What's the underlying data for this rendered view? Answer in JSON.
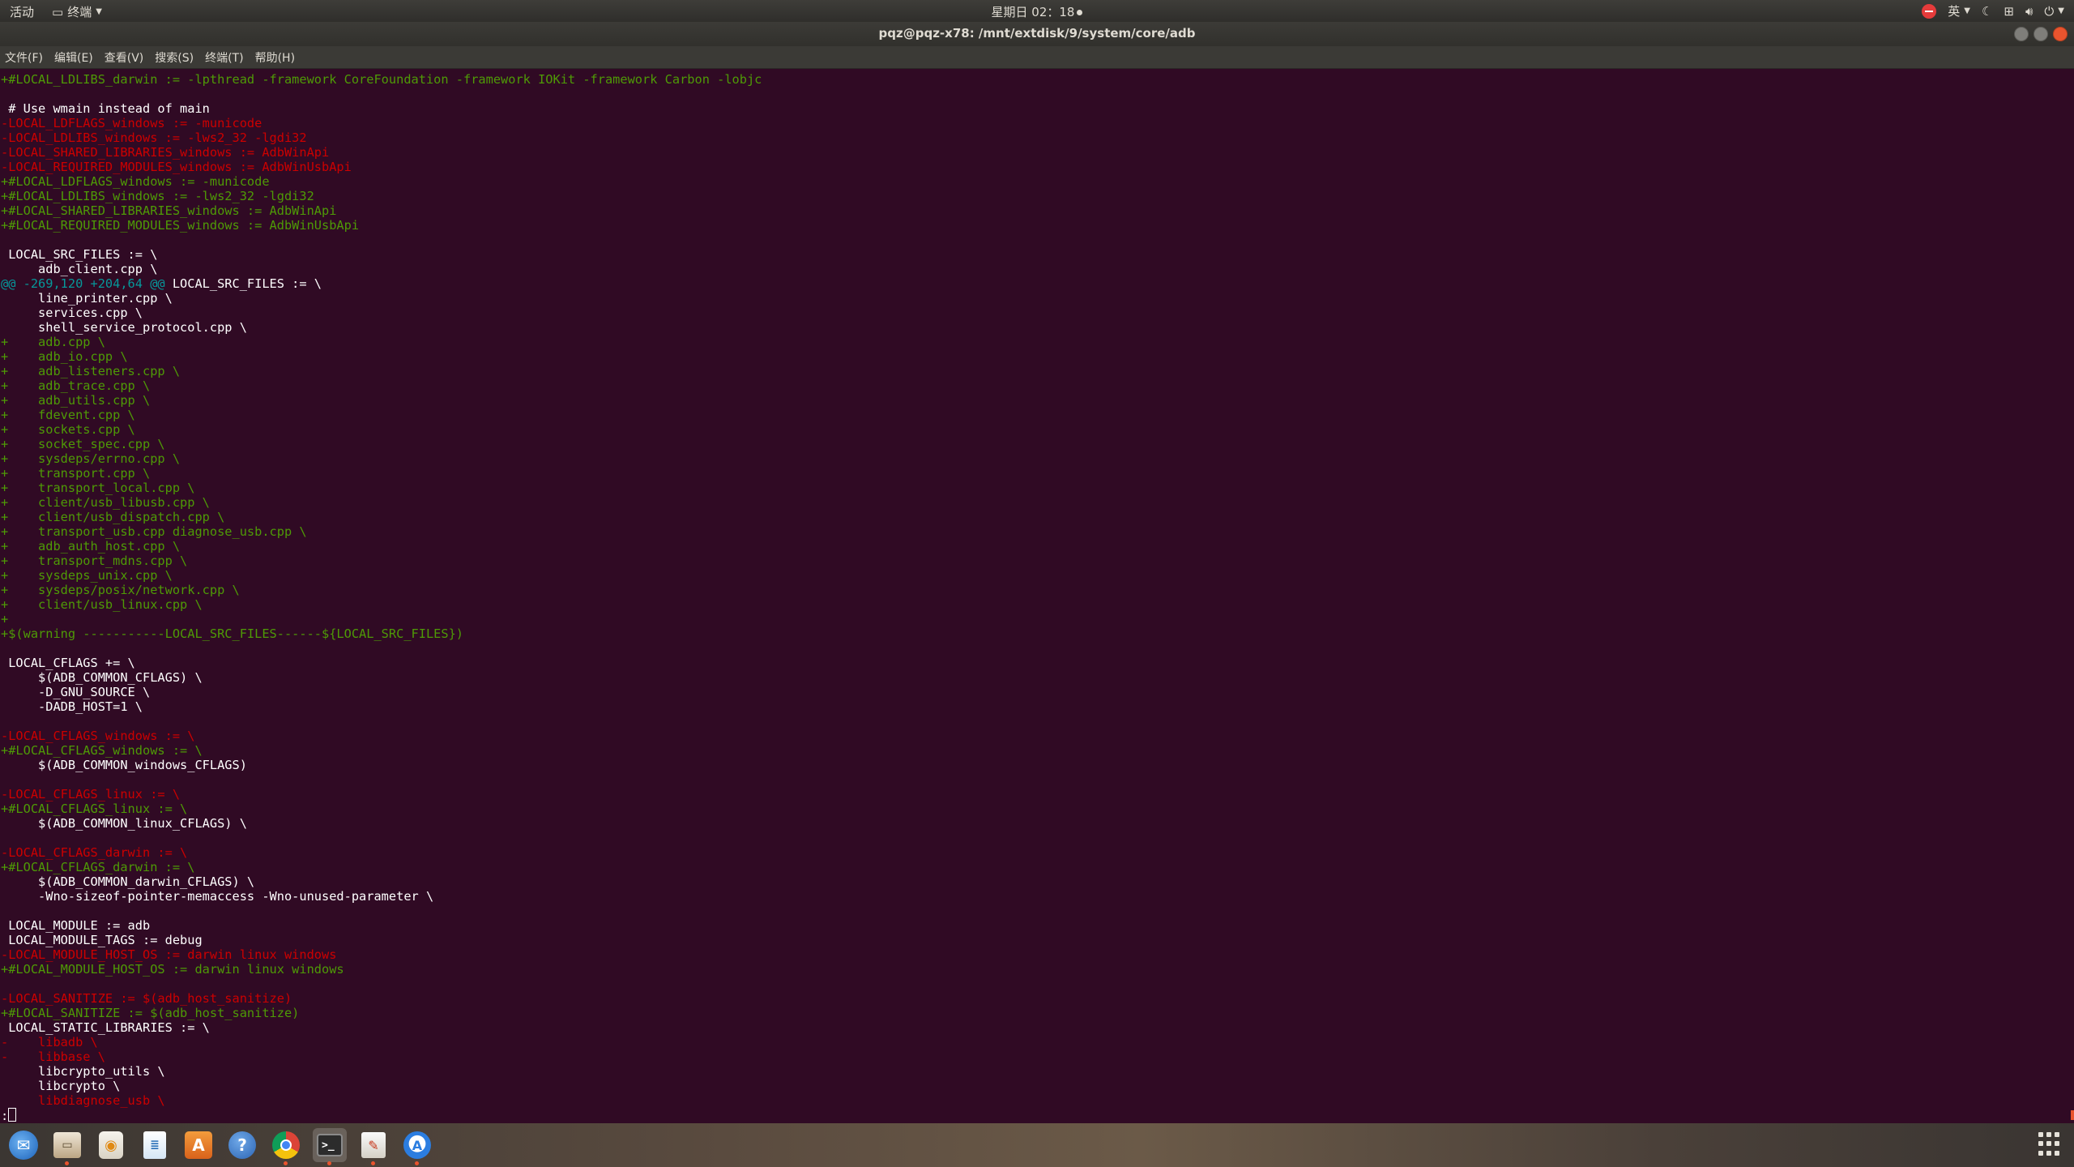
{
  "topbar": {
    "activities": "活动",
    "app_menu": "终端",
    "clock": "星期日 02：18",
    "input_method": "英"
  },
  "window": {
    "title": "pqz@pqz-x78: /mnt/extdisk/9/system/core/adb"
  },
  "menu": [
    "文件(F)",
    "编辑(E)",
    "查看(V)",
    "搜索(S)",
    "终端(T)",
    "帮助(H)"
  ],
  "colors": {
    "terminal_bg": "#300a24",
    "added": "#4e9a06",
    "removed": "#cc0000",
    "hunk": "#06989a",
    "context": "#ffffff"
  },
  "terminal": {
    "lines": [
      {
        "type": "add",
        "text": "+#LOCAL_LDLIBS_darwin := -lpthread -framework CoreFoundation -framework IOKit -framework Carbon -lobjc"
      },
      {
        "type": "ctx",
        "text": ""
      },
      {
        "type": "ctx",
        "text": " # Use wmain instead of main"
      },
      {
        "type": "del",
        "text": "-LOCAL_LDFLAGS_windows := -municode"
      },
      {
        "type": "del",
        "text": "-LOCAL_LDLIBS_windows := -lws2_32 -lgdi32"
      },
      {
        "type": "del",
        "text": "-LOCAL_SHARED_LIBRARIES_windows := AdbWinApi"
      },
      {
        "type": "del",
        "text": "-LOCAL_REQUIRED_MODULES_windows := AdbWinUsbApi"
      },
      {
        "type": "add",
        "text": "+#LOCAL_LDFLAGS_windows := -municode"
      },
      {
        "type": "add",
        "text": "+#LOCAL_LDLIBS_windows := -lws2_32 -lgdi32"
      },
      {
        "type": "add",
        "text": "+#LOCAL_SHARED_LIBRARIES_windows := AdbWinApi"
      },
      {
        "type": "add",
        "text": "+#LOCAL_REQUIRED_MODULES_windows := AdbWinUsbApi"
      },
      {
        "type": "ctx",
        "text": ""
      },
      {
        "type": "ctx",
        "text": " LOCAL_SRC_FILES := \\"
      },
      {
        "type": "ctx",
        "text": "     adb_client.cpp \\"
      },
      {
        "type": "hunk",
        "text": "@@ -269,120 +204,64 @@",
        "rest": " LOCAL_SRC_FILES := \\"
      },
      {
        "type": "ctx",
        "text": "     line_printer.cpp \\"
      },
      {
        "type": "ctx",
        "text": "     services.cpp \\"
      },
      {
        "type": "ctx",
        "text": "     shell_service_protocol.cpp \\"
      },
      {
        "type": "add",
        "text": "+    adb.cpp \\"
      },
      {
        "type": "add",
        "text": "+    adb_io.cpp \\"
      },
      {
        "type": "add",
        "text": "+    adb_listeners.cpp \\"
      },
      {
        "type": "add",
        "text": "+    adb_trace.cpp \\"
      },
      {
        "type": "add",
        "text": "+    adb_utils.cpp \\"
      },
      {
        "type": "add",
        "text": "+    fdevent.cpp \\"
      },
      {
        "type": "add",
        "text": "+    sockets.cpp \\"
      },
      {
        "type": "add",
        "text": "+    socket_spec.cpp \\"
      },
      {
        "type": "add",
        "text": "+    sysdeps/errno.cpp \\"
      },
      {
        "type": "add",
        "text": "+    transport.cpp \\"
      },
      {
        "type": "add",
        "text": "+    transport_local.cpp \\"
      },
      {
        "type": "add",
        "text": "+    client/usb_libusb.cpp \\"
      },
      {
        "type": "add",
        "text": "+    client/usb_dispatch.cpp \\"
      },
      {
        "type": "add",
        "text": "+    transport_usb.cpp diagnose_usb.cpp \\"
      },
      {
        "type": "add",
        "text": "+    adb_auth_host.cpp \\"
      },
      {
        "type": "add",
        "text": "+    transport_mdns.cpp \\"
      },
      {
        "type": "add",
        "text": "+    sysdeps_unix.cpp \\"
      },
      {
        "type": "add",
        "text": "+    sysdeps/posix/network.cpp \\"
      },
      {
        "type": "add",
        "text": "+    client/usb_linux.cpp \\"
      },
      {
        "type": "add",
        "text": "+"
      },
      {
        "type": "add",
        "text": "+$(warning -----------LOCAL_SRC_FILES------${LOCAL_SRC_FILES})"
      },
      {
        "type": "ctx",
        "text": ""
      },
      {
        "type": "ctx",
        "text": " LOCAL_CFLAGS += \\"
      },
      {
        "type": "ctx",
        "text": "     $(ADB_COMMON_CFLAGS) \\"
      },
      {
        "type": "ctx",
        "text": "     -D_GNU_SOURCE \\"
      },
      {
        "type": "ctx",
        "text": "     -DADB_HOST=1 \\"
      },
      {
        "type": "ctx",
        "text": ""
      },
      {
        "type": "del",
        "text": "-LOCAL_CFLAGS_windows := \\"
      },
      {
        "type": "add",
        "text": "+#LOCAL_CFLAGS_windows := \\"
      },
      {
        "type": "ctx",
        "text": "     $(ADB_COMMON_windows_CFLAGS)"
      },
      {
        "type": "ctx",
        "text": ""
      },
      {
        "type": "del",
        "text": "-LOCAL_CFLAGS_linux := \\"
      },
      {
        "type": "add",
        "text": "+#LOCAL_CFLAGS_linux := \\"
      },
      {
        "type": "ctx",
        "text": "     $(ADB_COMMON_linux_CFLAGS) \\"
      },
      {
        "type": "ctx",
        "text": ""
      },
      {
        "type": "del",
        "text": "-LOCAL_CFLAGS_darwin := \\"
      },
      {
        "type": "add",
        "text": "+#LOCAL_CFLAGS_darwin := \\"
      },
      {
        "type": "ctx",
        "text": "     $(ADB_COMMON_darwin_CFLAGS) \\"
      },
      {
        "type": "ctx",
        "text": "     -Wno-sizeof-pointer-memaccess -Wno-unused-parameter \\"
      },
      {
        "type": "ctx",
        "text": ""
      },
      {
        "type": "ctx",
        "text": " LOCAL_MODULE := adb"
      },
      {
        "type": "ctx",
        "text": " LOCAL_MODULE_TAGS := debug"
      },
      {
        "type": "del",
        "text": "-LOCAL_MODULE_HOST_OS := darwin linux windows"
      },
      {
        "type": "add",
        "text": "+#LOCAL_MODULE_HOST_OS := darwin linux windows"
      },
      {
        "type": "ctx",
        "text": ""
      },
      {
        "type": "del",
        "text": "-LOCAL_SANITIZE := $(adb_host_sanitize)"
      },
      {
        "type": "add",
        "text": "+#LOCAL_SANITIZE := $(adb_host_sanitize)"
      },
      {
        "type": "ctx",
        "text": " LOCAL_STATIC_LIBRARIES := \\"
      },
      {
        "type": "del",
        "text": "-    libadb \\"
      },
      {
        "type": "del",
        "text": "-    libbase \\"
      },
      {
        "type": "ctx",
        "text": "     libcrypto_utils \\"
      },
      {
        "type": "ctx",
        "text": "     libcrypto \\"
      },
      {
        "type": "del",
        "text": "     libdiagnose_usb \\"
      }
    ],
    "prompt": ":"
  },
  "dock": {
    "apps": [
      {
        "name": "thunderbird",
        "icon": "thunderbird-icon",
        "glyph": "✉",
        "running": false,
        "active": false
      },
      {
        "name": "files",
        "icon": "files-icon",
        "glyph": "▭",
        "running": true,
        "active": false
      },
      {
        "name": "rhythmbox",
        "icon": "rhythmbox-icon",
        "glyph": "◉",
        "running": false,
        "active": false
      },
      {
        "name": "libreoffice-writer",
        "icon": "writer-icon",
        "glyph": "≣",
        "running": false,
        "active": false
      },
      {
        "name": "software-center",
        "icon": "software-center-icon",
        "glyph": "A",
        "running": false,
        "active": false
      },
      {
        "name": "help",
        "icon": "help-icon",
        "glyph": "?",
        "running": false,
        "active": false
      },
      {
        "name": "chrome",
        "icon": "chrome-icon",
        "glyph": "",
        "running": true,
        "active": false
      },
      {
        "name": "terminal",
        "icon": "terminal-icon",
        "glyph": ">_",
        "running": true,
        "active": true
      },
      {
        "name": "text-editor",
        "icon": "text-editor-icon",
        "glyph": "✎",
        "running": true,
        "active": false
      },
      {
        "name": "software-updater",
        "icon": "software-updater-icon",
        "glyph": "A",
        "running": true,
        "active": false
      }
    ],
    "show_apps_icon": "grid-icon"
  }
}
